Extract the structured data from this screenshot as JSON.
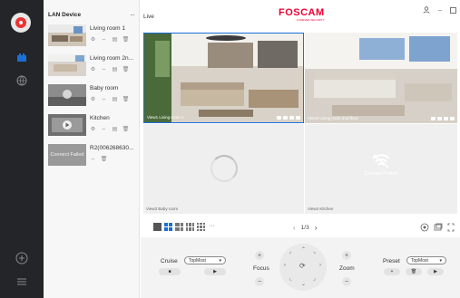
{
  "sidebar": {
    "items": [
      {
        "icon": "lan-device-icon",
        "active": true
      },
      {
        "icon": "globe-icon",
        "active": false
      }
    ],
    "bottom": [
      {
        "icon": "add-icon"
      },
      {
        "icon": "menu-icon"
      }
    ]
  },
  "device_list": {
    "title": "LAN Device",
    "more": "···",
    "devices": [
      {
        "name": "Living room 1"
      },
      {
        "name": "Living room 2n..."
      },
      {
        "name": "Baby room"
      },
      {
        "name": "Kitchen"
      },
      {
        "name": "R2(006268630...",
        "thumb_text": "Connect Failed"
      }
    ]
  },
  "header": {
    "live_label": "Live",
    "logo": "FOSCAM",
    "logo_sub": "FOREVER SECURITY"
  },
  "views": [
    {
      "label": "View1 Living room 1"
    },
    {
      "label": "View2 Living room 2nd floor"
    },
    {
      "label": "View3 Baby room"
    },
    {
      "label": "View4 Kitchen",
      "status": "Connect Failed"
    }
  ],
  "toolbar": {
    "page": "1/3",
    "more": "···"
  },
  "controls": {
    "cruise_label": "Cruise",
    "cruise_select": "TopMost",
    "focus_label": "Focus",
    "zoom_label": "Zoom",
    "preset_label": "Preset",
    "preset_select": "TopMost"
  },
  "colors": {
    "accent": "#1a6fd8",
    "brand": "#e0002a",
    "rail": "#232528"
  }
}
